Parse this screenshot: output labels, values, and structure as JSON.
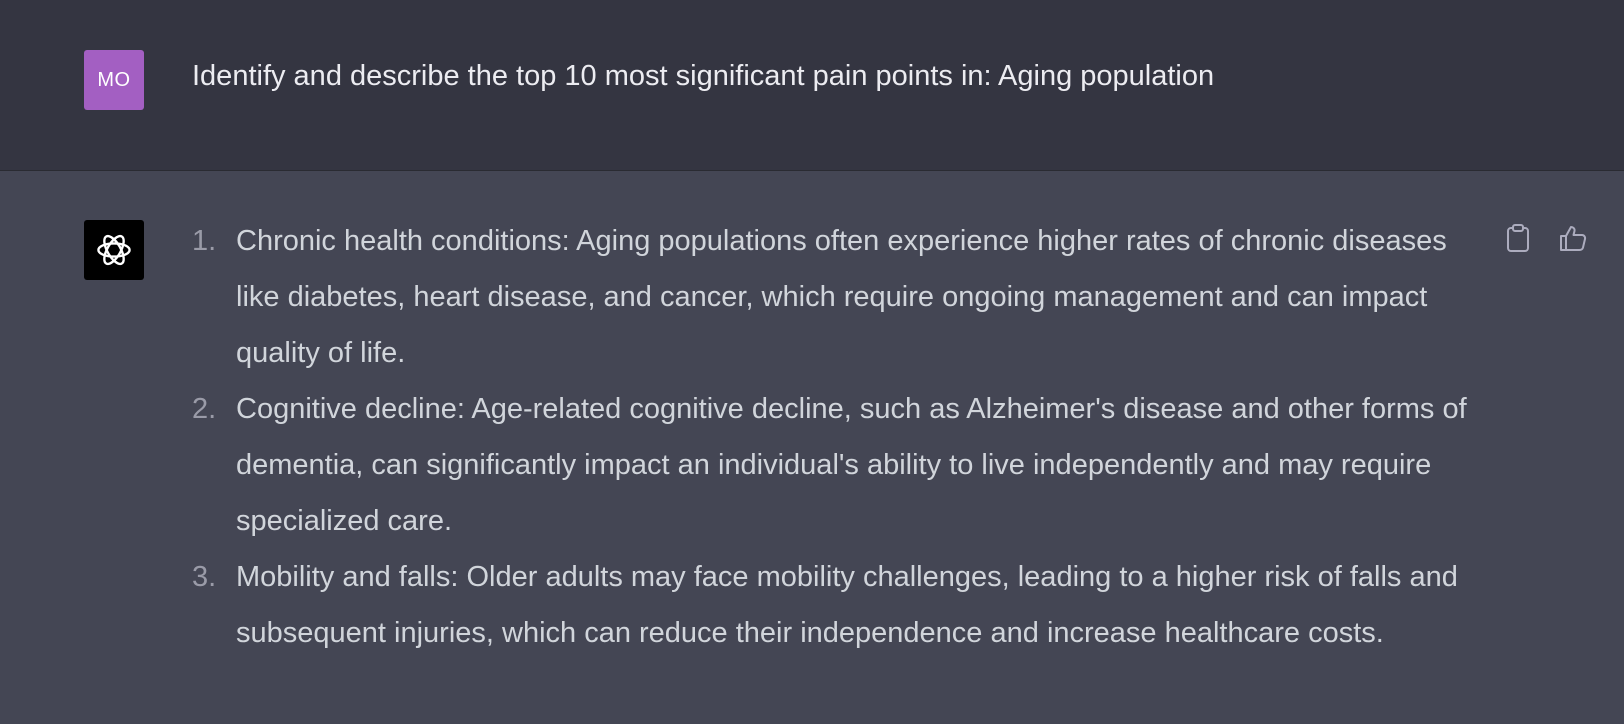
{
  "user": {
    "avatar_initials": "MO",
    "avatar_color": "#a35fc2",
    "message": "Identify and describe the top 10 most significant pain points in: Aging population"
  },
  "assistant": {
    "avatar_icon": "openai-logo-icon",
    "items": [
      {
        "number": "1.",
        "text": "Chronic health conditions: Aging populations often experience higher rates of chronic diseases like diabetes, heart disease, and cancer, which require ongoing management and can impact quality of life."
      },
      {
        "number": "2.",
        "text": "Cognitive decline: Age-related cognitive decline, such as Alzheimer's disease and other forms of dementia, can significantly impact an individual's ability to live independently and may require specialized care."
      },
      {
        "number": "3.",
        "text": "Mobility and falls: Older adults may face mobility challenges, leading to a higher risk of falls and subsequent injuries, which can reduce their independence and increase healthcare costs."
      }
    ],
    "actions": [
      {
        "name": "copy",
        "icon": "clipboard-icon"
      },
      {
        "name": "like",
        "icon": "thumbs-up-icon"
      }
    ]
  },
  "colors": {
    "user_bg": "#343541",
    "assistant_bg": "#444654",
    "text": "#d1d5db"
  }
}
